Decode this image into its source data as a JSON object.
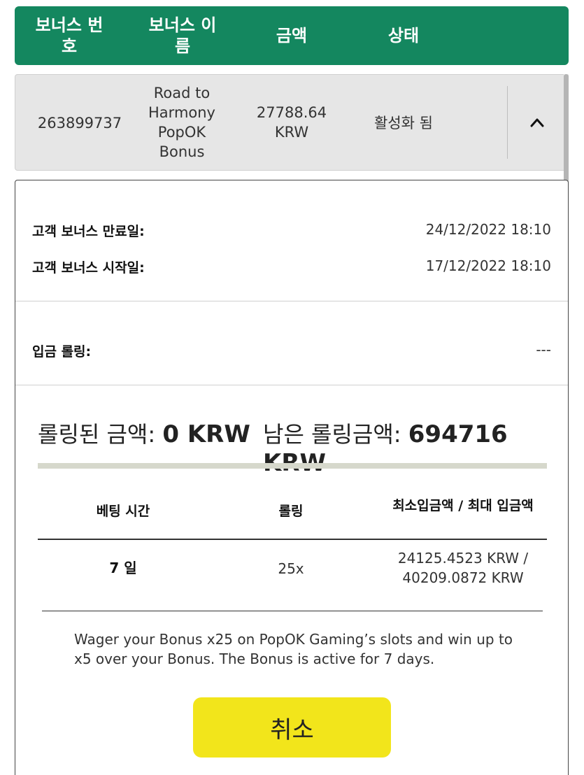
{
  "header": {
    "col_bonus_number": "보너스 번호",
    "col_bonus_name": "보너스 이름",
    "col_amount": "금액",
    "col_status": "상태",
    "bg_color": "#14875f"
  },
  "summary": {
    "bonus_id": "263899737",
    "bonus_name": "Road to Harmony PopOK Bonus",
    "amount_value": "27788.64",
    "amount_currency": "KRW",
    "status": "활성화 됨",
    "toggle_icon": "chevron-up-icon"
  },
  "details": {
    "expiry_label": "고객 보너스 만료일:",
    "expiry_value": "24/12/2022 18:10",
    "start_label": "고객 보너스 시작일:",
    "start_value": "17/12/2022 18:10",
    "deposit_rolling_label": "입금 롤링:",
    "deposit_rolling_value": "---"
  },
  "rolling": {
    "rolled_label": "롤링된 금액:",
    "rolled_value": "0 KRW",
    "remaining_label": "남은 롤링금액:",
    "remaining_value": "694716 KRW",
    "progress_fraction": 0
  },
  "terms_table": {
    "headers": [
      "베팅 시간",
      "롤링",
      "최소입금액 / 최대 입금액"
    ],
    "row": {
      "betting_time": "7 일",
      "rolling": "25x",
      "min_deposit": "24125.4523 KRW /",
      "max_deposit": "40209.0872 KRW"
    }
  },
  "description": "Wager your Bonus x25 on PopOK Gaming’s slots and win up to x5 over your Bonus. The Bonus is active for 7 days.",
  "cancel_button": {
    "label": "취소",
    "color": "#f2e51b"
  }
}
